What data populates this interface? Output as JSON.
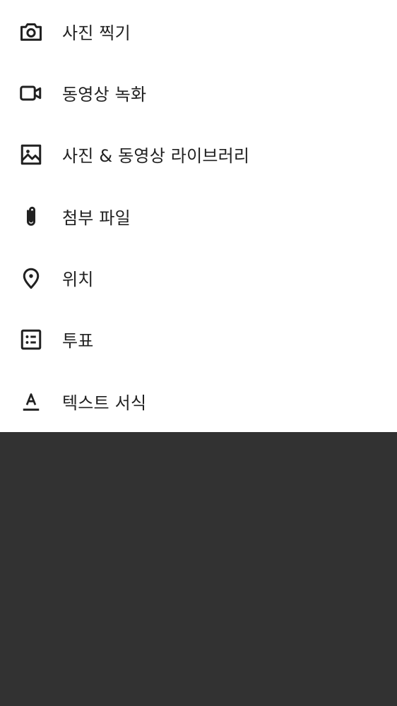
{
  "attachment_menu": {
    "items": [
      {
        "label": "사진 찍기",
        "icon": "camera-icon"
      },
      {
        "label": "동영상 녹화",
        "icon": "video-camera-icon"
      },
      {
        "label": "사진 & 동영상 라이브러리",
        "icon": "image-icon"
      },
      {
        "label": "첨부 파일",
        "icon": "paperclip-icon"
      },
      {
        "label": "위치",
        "icon": "location-pin-icon"
      },
      {
        "label": "투표",
        "icon": "poll-list-icon"
      },
      {
        "label": "텍스트 서식",
        "icon": "text-format-icon"
      }
    ]
  },
  "colors": {
    "sheet_background": "#ffffff",
    "overlay_background": "#323232",
    "icon_color": "#212121",
    "text_color": "#212121"
  }
}
